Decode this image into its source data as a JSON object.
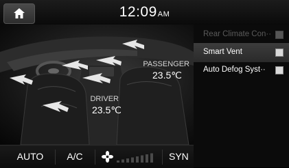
{
  "status_bar": {
    "time": "12:09",
    "ampm": "AM",
    "home_icon": "home-icon"
  },
  "seats": {
    "driver": {
      "label": "DRIVER",
      "temp": "23.5℃"
    },
    "passenger": {
      "label": "PASSENGER",
      "temp": "23.5℃"
    }
  },
  "options": [
    {
      "label": "Rear Climate Con··",
      "enabled": false,
      "checked": false
    },
    {
      "label": "Smart Vent",
      "enabled": true,
      "checked": true
    },
    {
      "label": "Auto Defog Syst··",
      "enabled": true,
      "checked": true
    }
  ],
  "controls": {
    "auto": "AUTO",
    "ac": "A/C",
    "sync": "SYN",
    "fan_icon": "fan-icon",
    "fan_level": 0
  }
}
